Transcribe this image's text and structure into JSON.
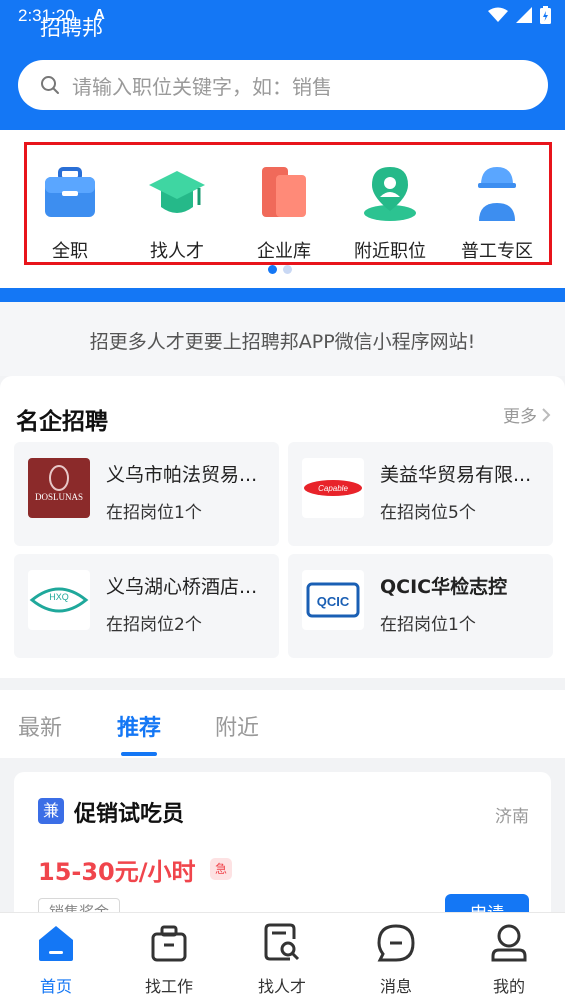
{
  "status_bar": {
    "time": "2:31:20",
    "indicator": "A"
  },
  "app": {
    "title": "招聘邦"
  },
  "search": {
    "placeholder": "请输入职位关键字，如：销售"
  },
  "categories": [
    {
      "label": "全职",
      "icon": "briefcase-icon"
    },
    {
      "label": "找人才",
      "icon": "graduation-cap-icon"
    },
    {
      "label": "企业库",
      "icon": "company-book-icon"
    },
    {
      "label": "附近职位",
      "icon": "location-pin-icon"
    },
    {
      "label": "普工专区",
      "icon": "worker-helmet-icon"
    }
  ],
  "promo": {
    "text": "招更多人才更要上招聘邦APP微信小程序网站!"
  },
  "famous": {
    "title": "名企招聘",
    "more_label": "更多",
    "companies": [
      {
        "name": "义乌市帕法贸易...",
        "count": "在招岗位1个",
        "logo_text": "DOSLUNAS"
      },
      {
        "name": "美益华贸易有限...",
        "count": "在招岗位5个",
        "logo_text": "Capable"
      },
      {
        "name": "义乌湖心桥酒店...",
        "count": "在招岗位2个",
        "logo_text": "HXQ"
      },
      {
        "name": "QCIC华检志控",
        "count": "在招岗位1个",
        "logo_text": "QCIC"
      }
    ]
  },
  "tabs": [
    {
      "label": "最新",
      "active": false
    },
    {
      "label": "推荐",
      "active": true
    },
    {
      "label": "附近",
      "active": false
    }
  ],
  "job": {
    "badge": "兼",
    "title": "促销试吃员",
    "city": "济南",
    "salary": "15-30元/小时",
    "urgent": "急",
    "tag": "销售奖金",
    "apply_label": "申请"
  },
  "bottom_nav": [
    {
      "label": "首页",
      "icon": "home-icon",
      "active": true
    },
    {
      "label": "找工作",
      "icon": "job-bag-icon",
      "active": false
    },
    {
      "label": "找人才",
      "icon": "resume-search-icon",
      "active": false
    },
    {
      "label": "消息",
      "icon": "message-icon",
      "active": false
    },
    {
      "label": "我的",
      "icon": "user-icon",
      "active": false
    }
  ],
  "colors": {
    "brand": "#1477f5",
    "salary": "#f0454c",
    "highlight_box": "#e8141b"
  }
}
